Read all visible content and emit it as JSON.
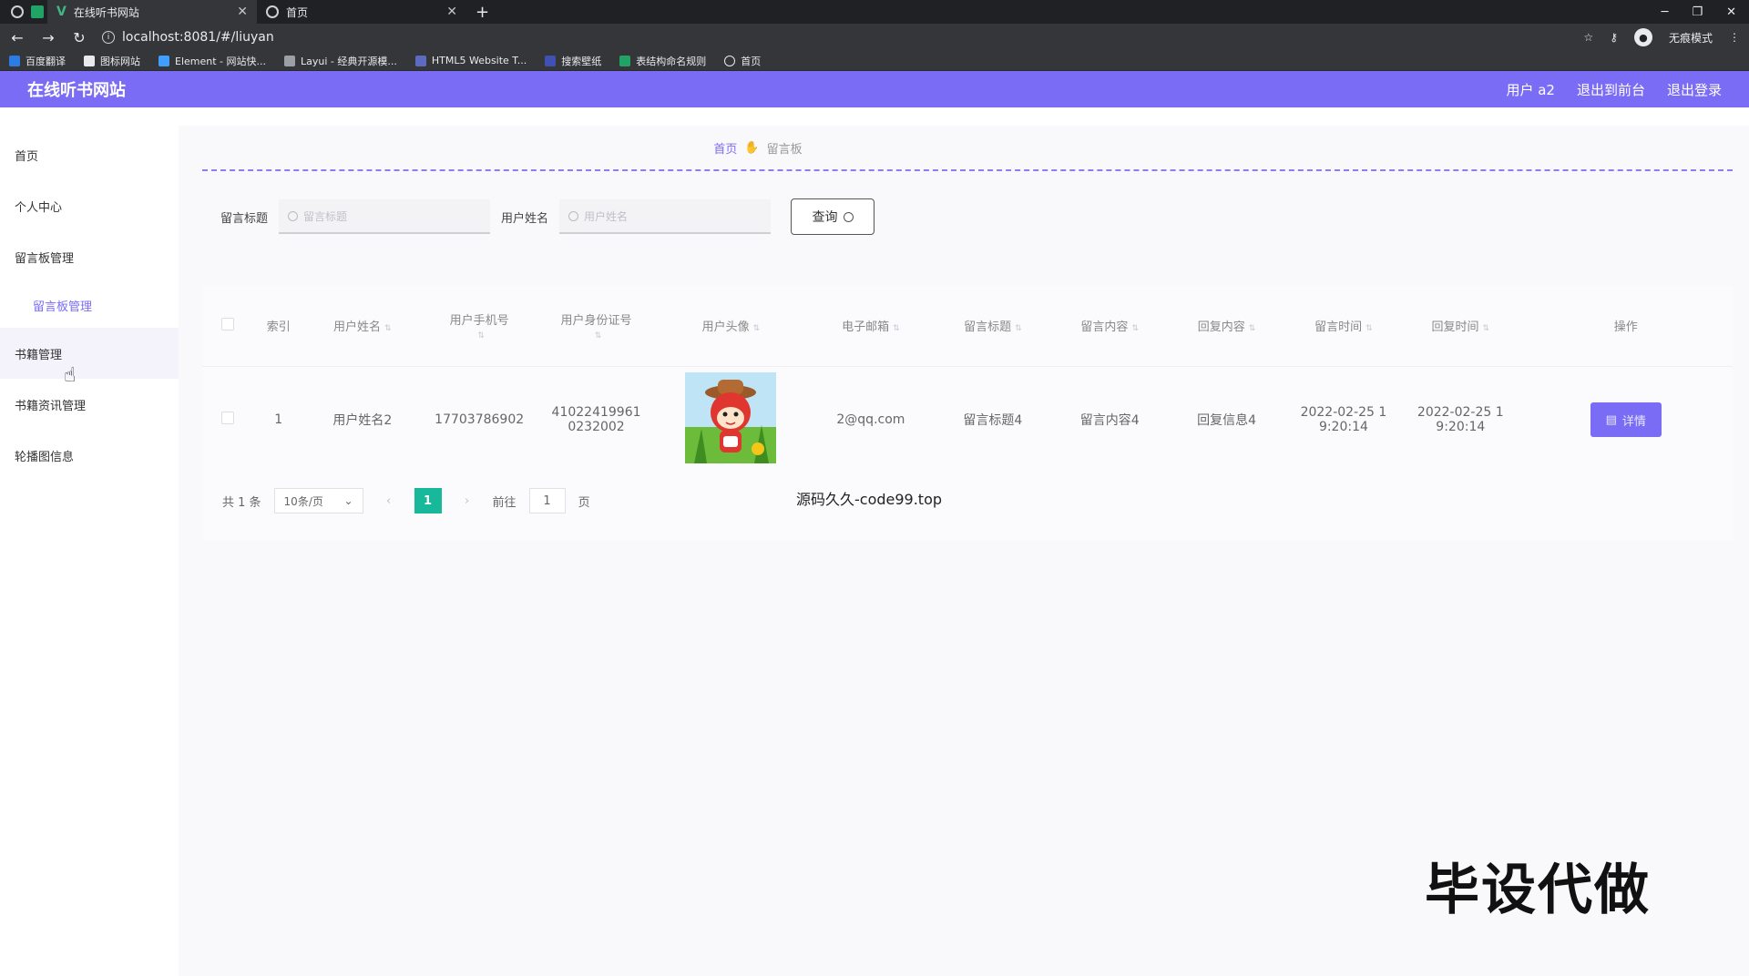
{
  "browser": {
    "tabs": [
      {
        "title": "在线听书网站",
        "active": true
      },
      {
        "title": "首页",
        "active": false
      }
    ],
    "url": "localhost:8081/#/liuyan",
    "incognito_label": "无痕模式",
    "bookmarks": [
      "百度翻译",
      "图标网站",
      "Element - 网站快...",
      "Layui - 经典开源模...",
      "HTML5 Website T...",
      "搜索壁纸",
      "表结构命名规则",
      "首页"
    ]
  },
  "header": {
    "title": "在线听书网站",
    "user": "用户 a2",
    "back_front": "退出到前台",
    "logout": "退出登录"
  },
  "sidebar": {
    "items": [
      {
        "label": "首页"
      },
      {
        "label": "个人中心"
      },
      {
        "label": "留言板管理"
      },
      {
        "label": "留言板管理"
      },
      {
        "label": "书籍管理"
      },
      {
        "label": "书籍资讯管理"
      },
      {
        "label": "轮播图信息"
      }
    ]
  },
  "breadcrumb": {
    "home": "首页",
    "current": "留言板"
  },
  "search": {
    "title_label": "留言标题",
    "title_placeholder": "留言标题",
    "name_label": "用户姓名",
    "name_placeholder": "用户姓名",
    "query_btn": "查询"
  },
  "table": {
    "headers": [
      "索引",
      "用户姓名",
      "用户手机号",
      "用户身份证号",
      "用户头像",
      "电子邮箱",
      "留言标题",
      "留言内容",
      "回复内容",
      "留言时间",
      "回复时间",
      "操作"
    ],
    "rows": [
      {
        "index": "1",
        "name": "用户姓名2",
        "phone": "17703786902",
        "id_card": "41022419961 0232002",
        "email": "2@qq.com",
        "title": "留言标题4",
        "content": "留言内容4",
        "reply": "回复信息4",
        "msg_time": "2022-02-25 1 9:20:14",
        "reply_time": "2022-02-25 1 9:20:14",
        "detail_btn": "详情"
      }
    ]
  },
  "pagination": {
    "total": "共 1 条",
    "page_size": "10条/页",
    "current": "1",
    "goto_prefix": "前往",
    "goto_value": "1",
    "goto_suffix": "页"
  },
  "overlay": {
    "source_label": "源码久久-code99.top",
    "big_watermark": "毕设代做"
  }
}
